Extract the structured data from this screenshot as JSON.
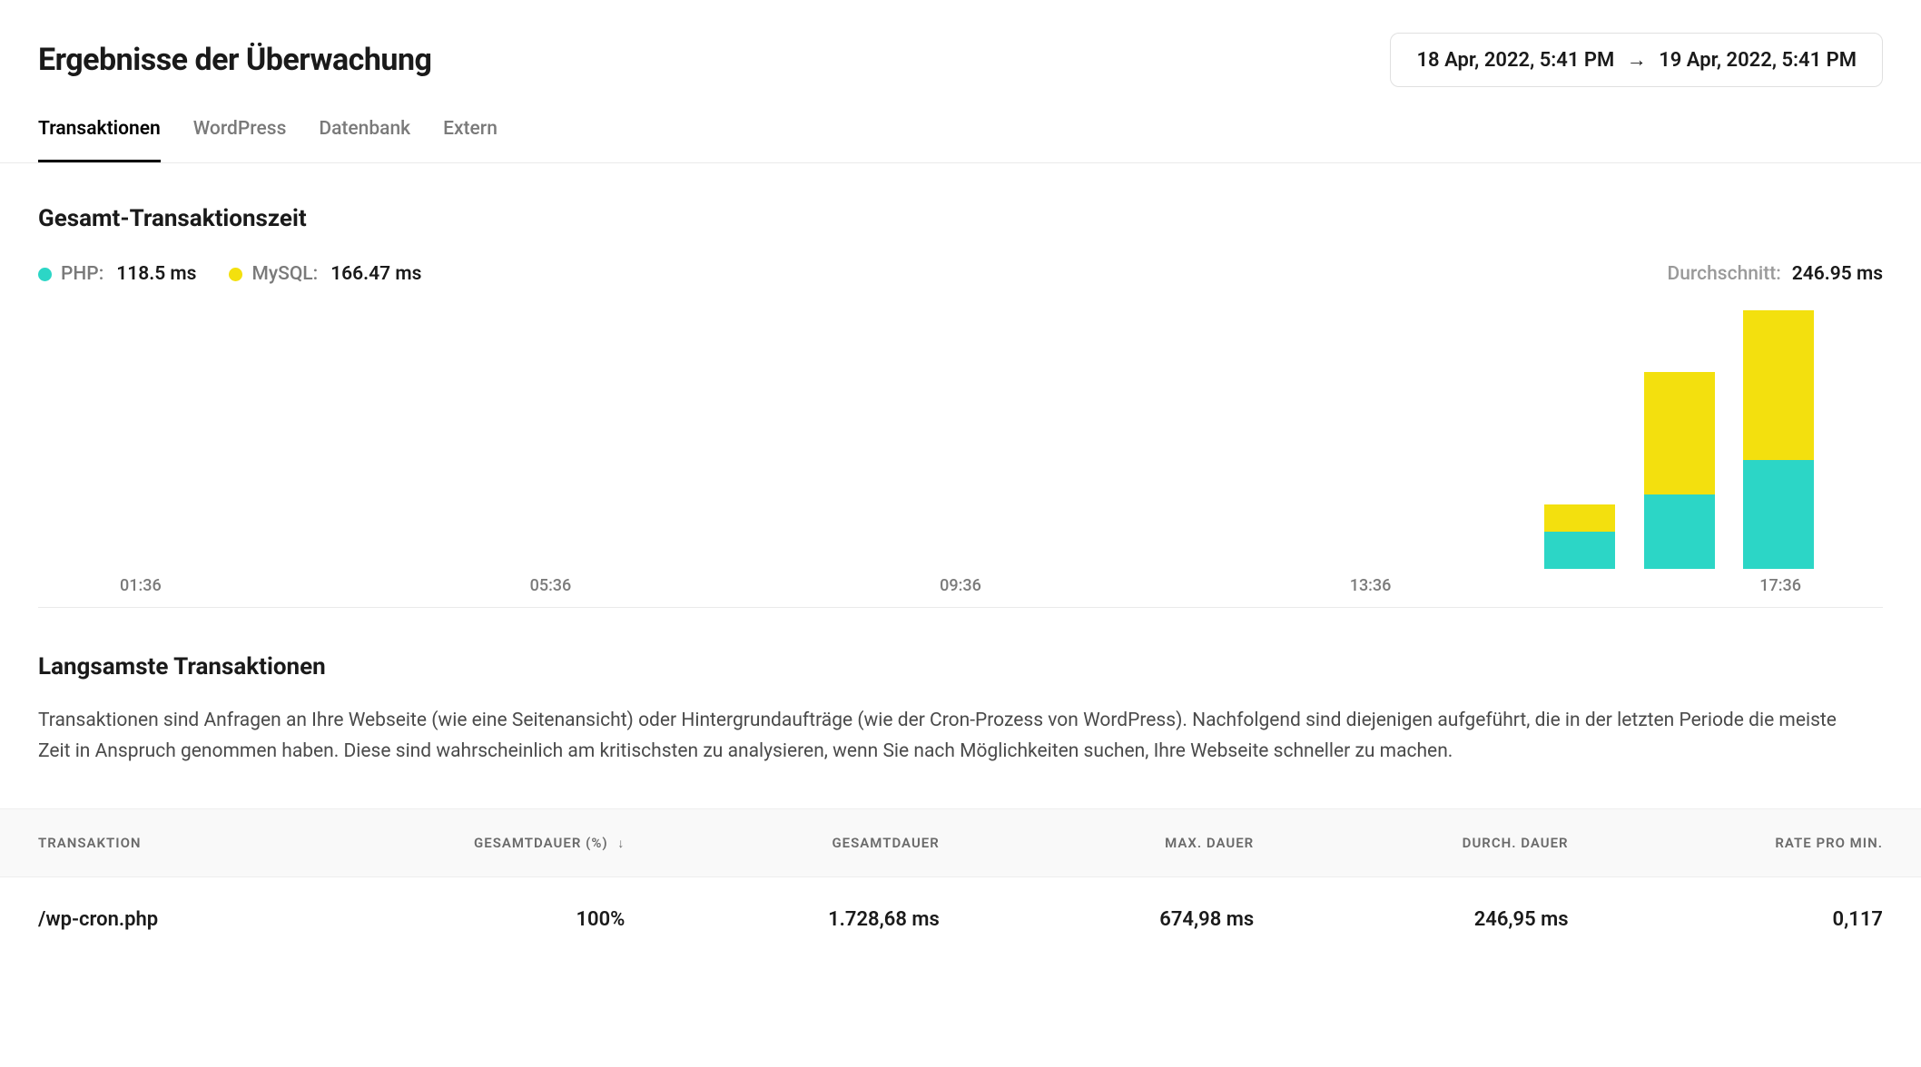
{
  "colors": {
    "php": "#2cd6c6",
    "mysql": "#f3e00e"
  },
  "header": {
    "title": "Ergebnisse der Überwachung",
    "date_from": "18 Apr, 2022, 5:41 PM",
    "date_to": "19 Apr, 2022, 5:41 PM"
  },
  "tabs": {
    "items": [
      {
        "id": "transaktionen",
        "label": "Transaktionen",
        "active": true
      },
      {
        "id": "wordpress",
        "label": "WordPress",
        "active": false
      },
      {
        "id": "datenbank",
        "label": "Datenbank",
        "active": false
      },
      {
        "id": "extern",
        "label": "Extern",
        "active": false
      }
    ]
  },
  "chart": {
    "title": "Gesamt-Transaktionszeit",
    "legend": {
      "php_label": "PHP:",
      "php_value": "118.5 ms",
      "mysql_label": "MySQL:",
      "mysql_value": "166.47 ms",
      "avg_label": "Durchschnitt:",
      "avg_value": "246.95 ms"
    },
    "x_labels": [
      "01:36",
      "05:36",
      "09:36",
      "13:36",
      "17:36"
    ]
  },
  "chart_data": {
    "type": "bar",
    "stacked": true,
    "categories_hours": [
      15,
      16,
      17
    ],
    "series": [
      {
        "name": "MySQL",
        "color": "#f3e00e",
        "values_ms": [
          40,
          180,
          220
        ]
      },
      {
        "name": "PHP",
        "color": "#2cd6c6",
        "values_ms": [
          55,
          110,
          160
        ]
      }
    ],
    "ylabel": "ms",
    "ylim": [
      0,
      400
    ],
    "x_axis_ticks": [
      "01:36",
      "05:36",
      "09:36",
      "13:36",
      "17:36"
    ],
    "x_axis_range_hours": [
      0,
      18
    ]
  },
  "slowest": {
    "title": "Langsamste Transaktionen",
    "description": "Transaktionen sind Anfragen an Ihre Webseite (wie eine Seitenansicht) oder Hintergrundaufträge (wie der Cron-Prozess von WordPress). Nachfolgend sind diejenigen aufgeführt, die in der letzten Periode die meiste Zeit in Anspruch genommen haben. Diese sind wahrscheinlich am kritischsten zu analysieren, wenn Sie nach Möglichkeiten suchen, Ihre Webseite schneller zu machen."
  },
  "table": {
    "columns": {
      "transaktion": "Transaktion",
      "gesamtdauer_pct": "Gesamtdauer (%)",
      "gesamtdauer": "Gesamtdauer",
      "max_dauer": "Max. Dauer",
      "durch_dauer": "Durch. Dauer",
      "rate_pro_min": "Rate pro Min."
    },
    "rows": [
      {
        "transaktion": "/wp-cron.php",
        "gesamtdauer_pct": "100%",
        "gesamtdauer": "1.728,68 ms",
        "max_dauer": "674,98 ms",
        "durch_dauer": "246,95 ms",
        "rate_pro_min": "0,117"
      }
    ]
  }
}
